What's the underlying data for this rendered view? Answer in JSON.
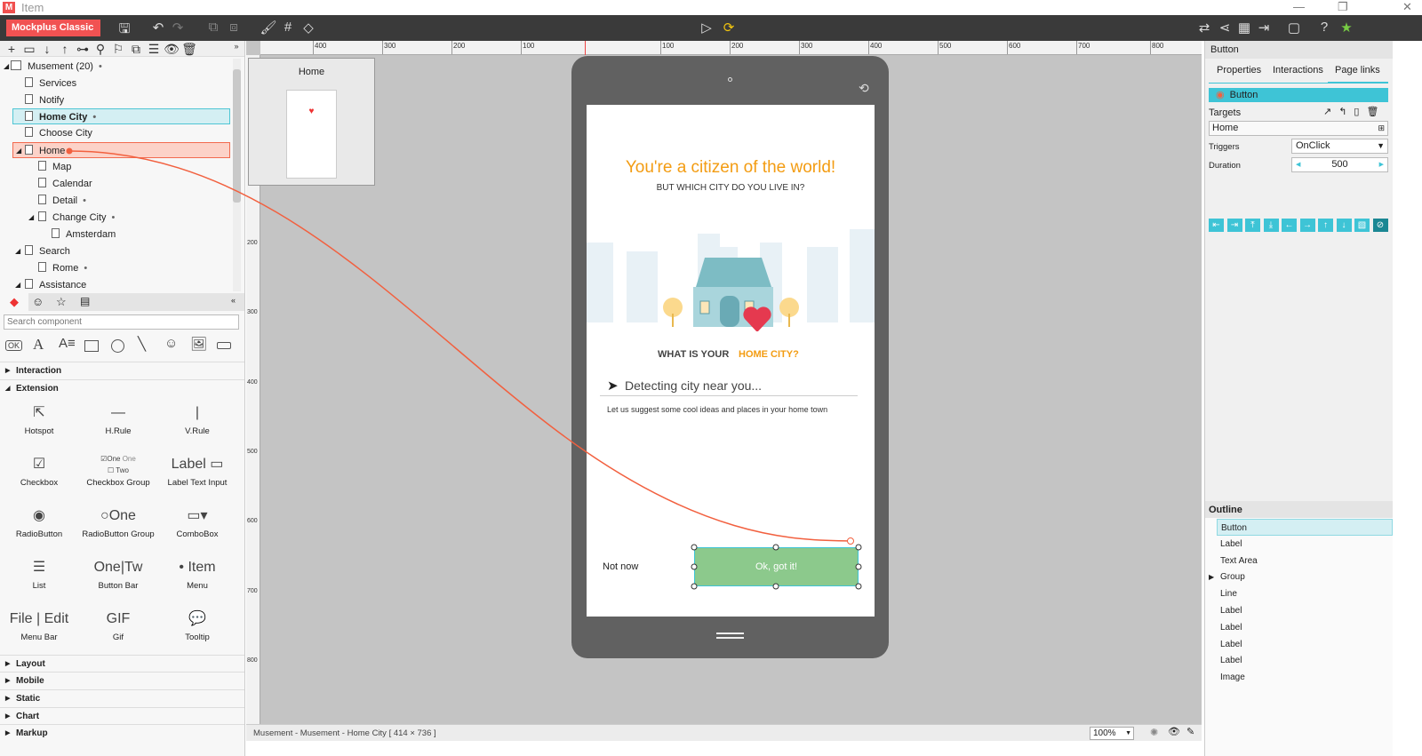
{
  "window": {
    "title": "Item",
    "minimize": "—",
    "maximize": "❐",
    "close": "✕"
  },
  "toolbar": {
    "brand": "Mockplus Classic ▾"
  },
  "pages": {
    "items": [
      {
        "label": "Musement (20)",
        "dot": "•"
      },
      {
        "label": "Services"
      },
      {
        "label": "Notify"
      },
      {
        "label": "Home City",
        "dot": "•"
      },
      {
        "label": "Choose City"
      },
      {
        "label": "Home"
      },
      {
        "label": "Map"
      },
      {
        "label": "Calendar"
      },
      {
        "label": "Detail",
        "dot": "•"
      },
      {
        "label": "Change City",
        "dot": "•"
      },
      {
        "label": "Amsterdam"
      },
      {
        "label": "Search"
      },
      {
        "label": "Rome",
        "dot": "•"
      },
      {
        "label": "Assistance"
      }
    ]
  },
  "components": {
    "search_placeholder": "Search component",
    "sections": [
      "Interaction",
      "Extension",
      "Layout",
      "Mobile",
      "Static",
      "Chart",
      "Markup"
    ],
    "extension": [
      {
        "label": "Hotspot",
        "icon": "⇱"
      },
      {
        "label": "H.Rule",
        "icon": "—"
      },
      {
        "label": "V.Rule",
        "icon": "|"
      },
      {
        "label": "Checkbox",
        "icon": "☑"
      },
      {
        "label": "Checkbox Group",
        "icon": "☑One"
      },
      {
        "label": "Label Text Input",
        "icon": "Label ▭"
      },
      {
        "label": "RadioButton",
        "icon": "◉"
      },
      {
        "label": "RadioButton Group",
        "icon": "○One"
      },
      {
        "label": "ComboBox",
        "icon": "▭▾"
      },
      {
        "label": "List",
        "icon": "☰"
      },
      {
        "label": "Button Bar",
        "icon": "One|Tw"
      },
      {
        "label": "Menu",
        "icon": "• Item"
      },
      {
        "label": "Menu Bar",
        "icon": "File | Edit"
      },
      {
        "label": "Gif",
        "icon": "GIF"
      },
      {
        "label": "Tooltip",
        "icon": "💬"
      }
    ],
    "extension_sub": {
      "checkbox_one": "One",
      "checkbox_two": "Two"
    }
  },
  "ruler": {
    "top": [
      "400",
      "300",
      "200",
      "100",
      "100",
      "200",
      "300",
      "400",
      "500",
      "600",
      "700",
      "800"
    ],
    "left": [
      "200",
      "300",
      "400",
      "500",
      "600",
      "700",
      "800"
    ]
  },
  "thumbnail": {
    "label": "Home"
  },
  "screen": {
    "headline": "You're a citizen of the world!",
    "subhead": "BUT WHICH CITY DO YOU LIVE IN?",
    "question_a": "WHAT IS YOUR",
    "question_b": "HOME CITY?",
    "detecting": "Detecting city near you...",
    "suggest": "Let us suggest some cool ideas and places in your home town",
    "not_now": "Not now",
    "ok": "Ok, got it!"
  },
  "right": {
    "header": "Button",
    "tabs": [
      "Properties",
      "Interactions",
      "Page links"
    ],
    "link_item": "Button",
    "targets_label": "Targets",
    "target_value": "Home",
    "triggers_label": "Triggers",
    "trigger_value": "OnClick",
    "duration_label": "Duration",
    "duration_value": "500",
    "transitions": [
      "⇤",
      "⇥",
      "⤒",
      "⤓",
      "←",
      "→",
      "↑",
      "↓",
      "▧",
      "⊘"
    ],
    "outline_title": "Outline",
    "outline": [
      "Button",
      "Label",
      "Text Area",
      "Group",
      "Line",
      "Label",
      "Label",
      "Label",
      "Label",
      "Image"
    ]
  },
  "status": {
    "text": "Musement - Musement - Home City [ 414 × 736 ]",
    "zoom": "100%"
  },
  "colors": {
    "accent": "#3ec4d6",
    "brand": "#f15252",
    "orange": "#f39c12",
    "link": "#f26a4f",
    "button": "#8cc98c"
  }
}
